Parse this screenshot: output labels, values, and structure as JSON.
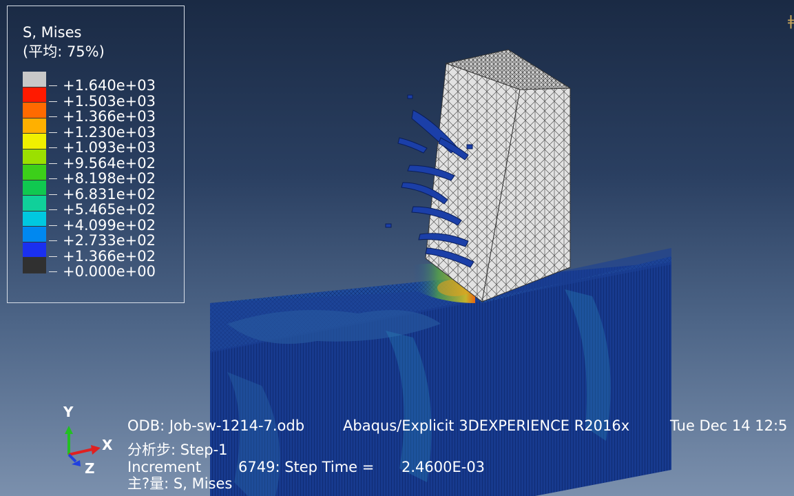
{
  "legend": {
    "title": "S, Mises",
    "average": "(平均: 75%)",
    "values": [
      "+1.640e+03",
      "+1.503e+03",
      "+1.366e+03",
      "+1.230e+03",
      "+1.093e+03",
      "+9.564e+02",
      "+8.198e+02",
      "+6.831e+02",
      "+5.465e+02",
      "+4.099e+02",
      "+2.733e+02",
      "+1.366e+02",
      "+0.000e+00"
    ],
    "colors": [
      "#c8c8c8",
      "#ff1a00",
      "#ff6a00",
      "#ffb000",
      "#f0f000",
      "#9be000",
      "#3ccf1a",
      "#10c850",
      "#10d09a",
      "#00c8e0",
      "#0088f0",
      "#1a30f0",
      "#303030"
    ]
  },
  "triad": {
    "y": "Y",
    "x": "X",
    "z": "Z"
  },
  "info": {
    "odb": "ODB: Job-sw-1214-7.odb",
    "product": "Abaqus/Explicit 3DEXPERIENCE R2016x",
    "date": "Tue Dec 14 12:5",
    "step": "分析步: Step-1",
    "increment_label": "Increment",
    "increment_value": "6749: Step Time =",
    "step_time": "2.4600E-03",
    "primary_var": "主?量: S, Mises"
  },
  "colors": {
    "workpiece": "#1c3a8c",
    "tool": "#d9d9d9"
  }
}
